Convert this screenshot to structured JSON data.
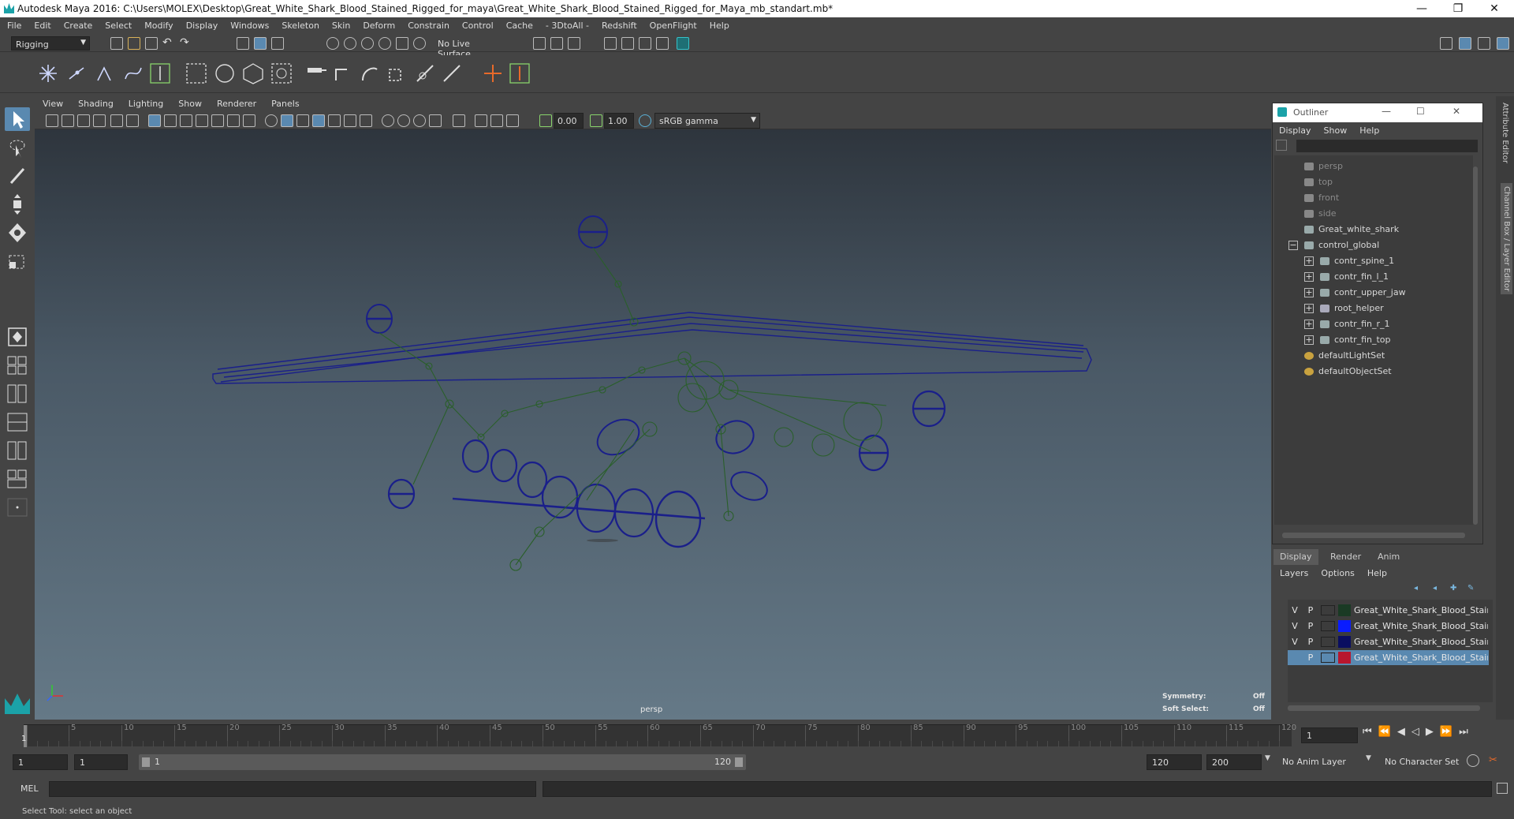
{
  "window": {
    "title": "Autodesk Maya 2016: C:\\Users\\MOLEX\\Desktop\\Great_White_Shark_Blood_Stained_Rigged_for_maya\\Great_White_Shark_Blood_Stained_Rigged_for_Maya_mb_standart.mb*"
  },
  "menu": [
    "File",
    "Edit",
    "Create",
    "Select",
    "Modify",
    "Display",
    "Windows",
    "Skeleton",
    "Skin",
    "Deform",
    "Constrain",
    "Control",
    "Cache",
    "- 3DtoAll -",
    "Redshift",
    "OpenFlight",
    "Help"
  ],
  "status": {
    "menuset": "Rigging",
    "live_surface": "No Live Surface"
  },
  "viewport_menu": [
    "View",
    "Shading",
    "Lighting",
    "Show",
    "Renderer",
    "Panels"
  ],
  "viewport_toolbar": {
    "near_value": "0.00",
    "gamma_value": "1.00",
    "color_space": "sRGB gamma"
  },
  "viewport": {
    "camera_label": "persp",
    "symmetry_label": "Symmetry:",
    "symmetry_value": "Off",
    "soft_select_label": "Soft Select:",
    "soft_select_value": "Off"
  },
  "outliner": {
    "title": "Outliner",
    "menu": [
      "Display",
      "Show",
      "Help"
    ],
    "items": [
      {
        "label": "persp",
        "dim": true,
        "icon": "camera-icon"
      },
      {
        "label": "top",
        "dim": true,
        "icon": "camera-icon"
      },
      {
        "label": "front",
        "dim": true,
        "icon": "camera-icon"
      },
      {
        "label": "side",
        "dim": true,
        "icon": "camera-icon"
      },
      {
        "label": "Great_white_shark",
        "dim": false,
        "icon": "transform-icon"
      },
      {
        "label": "control_global",
        "dim": false,
        "icon": "transform-icon"
      },
      {
        "label": "contr_spine_1",
        "dim": false,
        "icon": "transform-icon"
      },
      {
        "label": "contr_fin_l_1",
        "dim": false,
        "icon": "transform-icon"
      },
      {
        "label": "contr_upper_jaw",
        "dim": false,
        "icon": "transform-icon"
      },
      {
        "label": "root_helper",
        "dim": false,
        "icon": "locator-icon"
      },
      {
        "label": "contr_fin_r_1",
        "dim": false,
        "icon": "transform-icon"
      },
      {
        "label": "contr_fin_top",
        "dim": false,
        "icon": "transform-icon"
      },
      {
        "label": "defaultLightSet",
        "dim": false,
        "icon": "set-icon"
      },
      {
        "label": "defaultObjectSet",
        "dim": false,
        "icon": "set-icon"
      }
    ]
  },
  "layer_editor": {
    "tabs": [
      "Display",
      "Render",
      "Anim"
    ],
    "menu": [
      "Layers",
      "Options",
      "Help"
    ],
    "layers": [
      {
        "v": "V",
        "p": "P",
        "color": "#1a3a24",
        "name": "Great_White_Shark_Blood_Stained"
      },
      {
        "v": "V",
        "p": "P",
        "color": "#0a1cff",
        "name": "Great_White_Shark_Blood_Stained"
      },
      {
        "v": "V",
        "p": "P",
        "color": "#0a0e60",
        "name": "Great_White_Shark_Blood_Stained"
      },
      {
        "v": "",
        "p": "P",
        "color": "#b8162e",
        "name": "Great_White_Shark_Blood_Stained"
      }
    ]
  },
  "right_strip": {
    "attribute_editor": "Attribute Editor",
    "channel_box": "Channel Box / Layer Editor"
  },
  "timeline": {
    "ticks": [
      "1",
      "5",
      "10",
      "15",
      "20",
      "25",
      "30",
      "35",
      "40",
      "45",
      "50",
      "55",
      "60",
      "65",
      "70",
      "75",
      "80",
      "85",
      "90",
      "95",
      "100",
      "105",
      "110",
      "115",
      "120"
    ],
    "current_frame": "1"
  },
  "range": {
    "start": "1",
    "anim_start": "1",
    "slider_start": "1",
    "slider_end": "120",
    "end": "120",
    "anim_end": "200",
    "anim_layer": "No Anim Layer",
    "character_set": "No Character Set"
  },
  "command_line": {
    "label": "MEL"
  },
  "help_line": "Select Tool: select an object"
}
